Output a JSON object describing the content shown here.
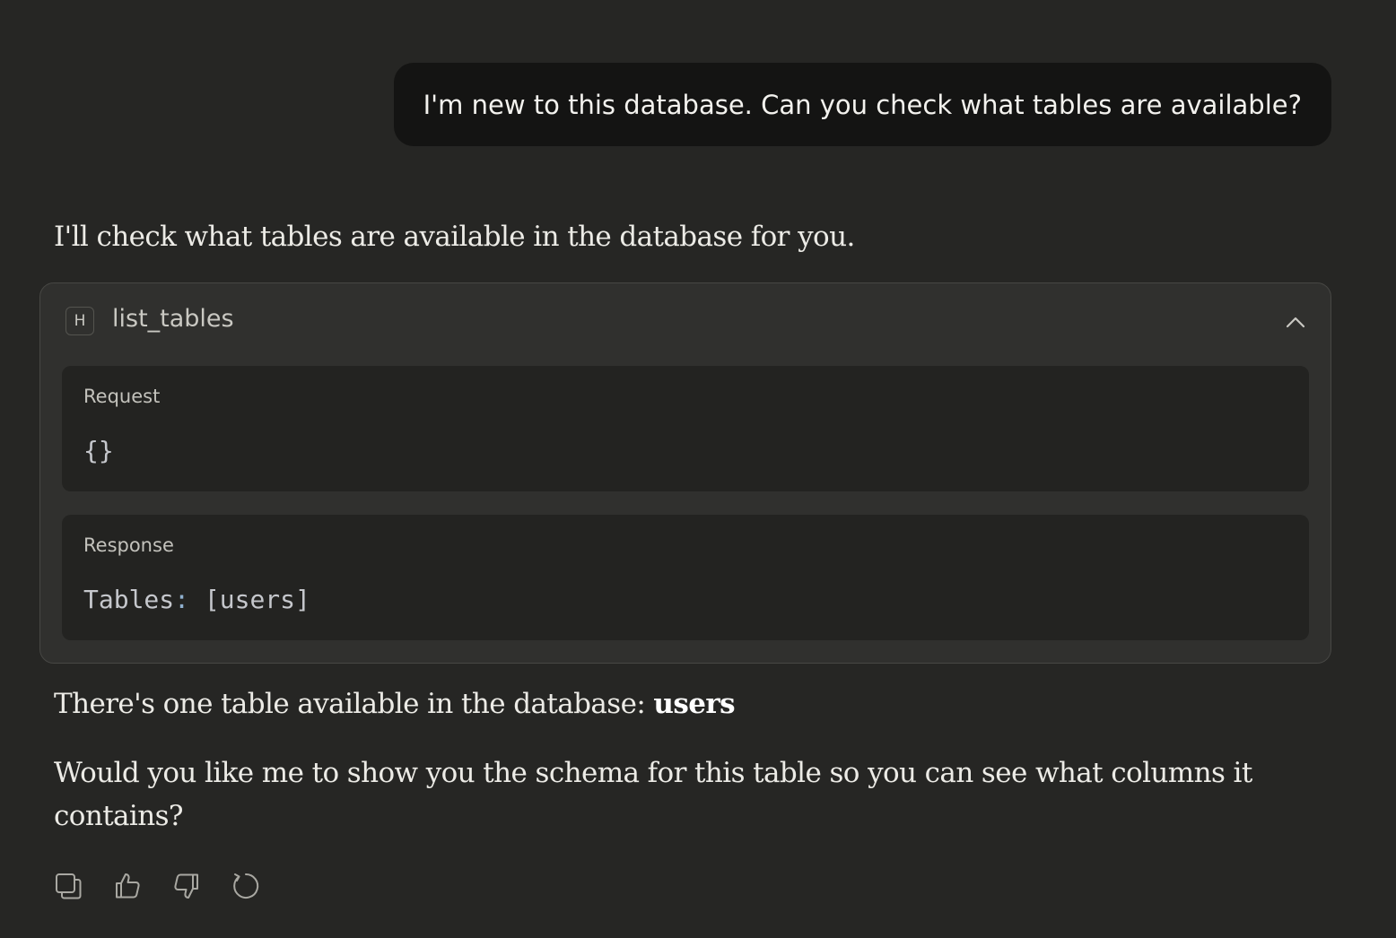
{
  "conversation": {
    "user_message": "I'm new to this database. Can you check what tables are available?",
    "assistant_intro": "I'll check what tables are available in the database for you.",
    "tool_call": {
      "badge": "H",
      "name": "list_tables",
      "toggle_icon": "chevron-up-icon",
      "request_label": "Request",
      "request_body": "{}",
      "response_label": "Response",
      "response_key": "Tables",
      "response_colon": ":",
      "response_value": " [users]"
    },
    "answer_prefix": "There's one table available in the database: ",
    "answer_table": "users",
    "followup": "Would you like me to show you the schema for this table so you can see what columns it contains?"
  },
  "actions": [
    {
      "icon": "copy-icon"
    },
    {
      "icon": "thumbs-up-icon"
    },
    {
      "icon": "thumbs-down-icon"
    },
    {
      "icon": "retry-icon"
    }
  ],
  "colors": {
    "background": "#262624",
    "user_bubble": "#141413",
    "tool_card": "#30302e",
    "panel": "#232321"
  }
}
